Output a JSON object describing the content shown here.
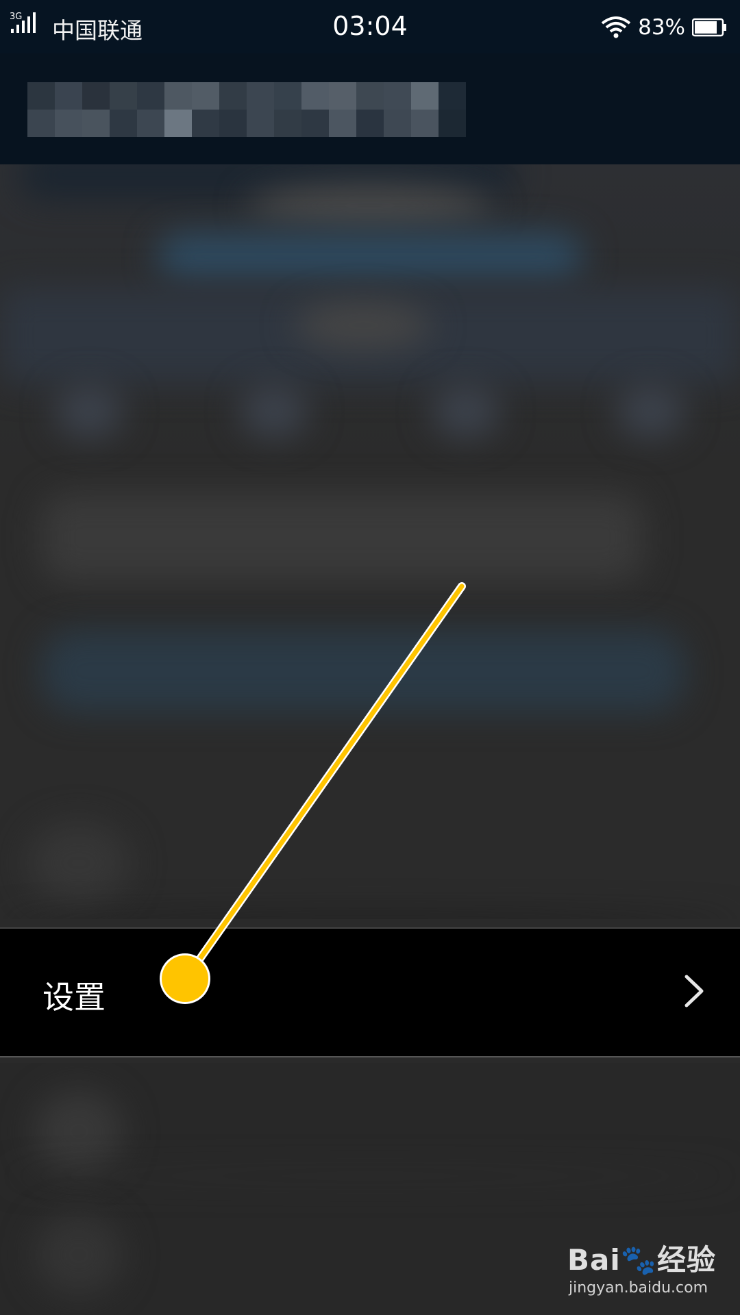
{
  "status_bar": {
    "network": "3G",
    "carrier": "中国联通",
    "time": "03:04",
    "battery": "83%",
    "icons": [
      "signal-icon",
      "wifi-icon",
      "battery-icon"
    ]
  },
  "menu": {
    "item_label": "设置",
    "item_icon": "chevron-right-icon"
  },
  "annotation": {
    "color": "#FFC400"
  },
  "watermark": {
    "logo": "Bai🐾经验",
    "url": "jingyan.baidu.com"
  }
}
